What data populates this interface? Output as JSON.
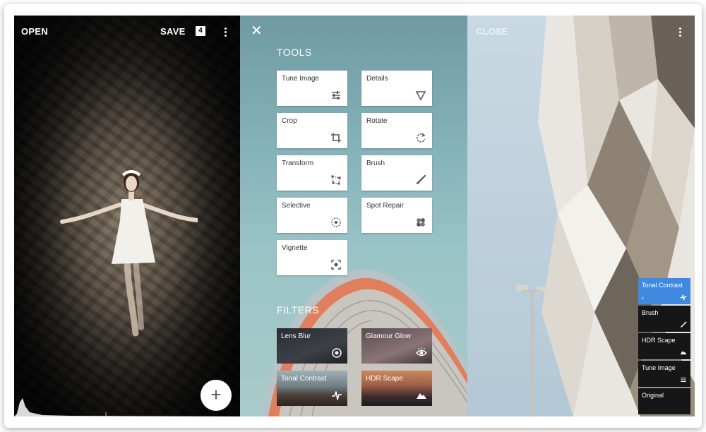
{
  "editor": {
    "open_label": "OPEN",
    "save_label": "SAVE",
    "badge": "4"
  },
  "tools_panel": {
    "tools_title": "TOOLS",
    "filters_title": "FILTERS",
    "tools": [
      {
        "label": "Tune Image",
        "icon": "sliders-icon"
      },
      {
        "label": "Details",
        "icon": "triangle-icon"
      },
      {
        "label": "Crop",
        "icon": "crop-icon"
      },
      {
        "label": "Rotate",
        "icon": "rotate-icon"
      },
      {
        "label": "Transform",
        "icon": "transform-icon"
      },
      {
        "label": "Brush",
        "icon": "brush-icon"
      },
      {
        "label": "Selective",
        "icon": "selective-icon"
      },
      {
        "label": "Spot Repair",
        "icon": "bandage-icon"
      },
      {
        "label": "Vignette",
        "icon": "vignette-icon"
      }
    ],
    "filters": [
      {
        "label": "Lens Blur",
        "icon": "target-icon"
      },
      {
        "label": "Glamour Glow",
        "icon": "eye-icon"
      },
      {
        "label": "Tonal Contrast",
        "icon": "pulse-icon"
      },
      {
        "label": "HDR Scape",
        "icon": "mountain-icon"
      }
    ]
  },
  "stack_panel": {
    "close_label": "CLOSE",
    "stack": [
      {
        "label": "Tonal Contrast",
        "active": true
      },
      {
        "label": "Brush",
        "active": false
      },
      {
        "label": "HDR Scape",
        "active": false
      },
      {
        "label": "Tune Image",
        "active": false
      },
      {
        "label": "Original",
        "active": false
      }
    ]
  },
  "colors": {
    "accent_blue": "#3f8ae0",
    "stack_dark": "#161616"
  }
}
